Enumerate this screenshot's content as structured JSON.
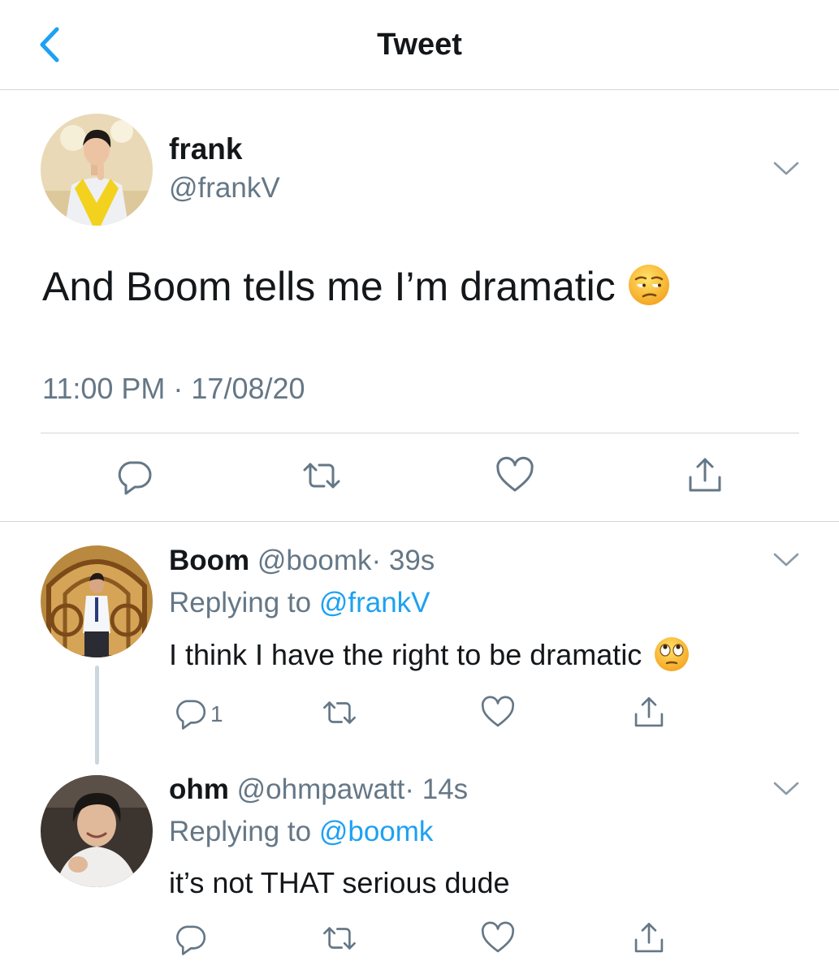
{
  "header": {
    "title": "Tweet",
    "back_icon": "chevron-left-icon",
    "accent": "#1da1f2"
  },
  "main_tweet": {
    "name": "frank",
    "handle": "@frankV",
    "text": "And Boom tells me I’m dramatic",
    "emoji": "unamused-face-icon",
    "timestamp": "11:00 PM · 17/08/20"
  },
  "replies": [
    {
      "name": "Boom",
      "handle": "@boomk",
      "time": "· 39s",
      "replying_label": "Replying to",
      "replying_handle": "@frankV",
      "text": "I think I have the right to be dramatic",
      "emoji": "eye-roll-face-icon",
      "reply_count": "1"
    },
    {
      "name": "ohm",
      "handle": "@ohmpawatt",
      "time": "· 14s",
      "replying_label": "Replying to",
      "replying_handle": "@boomk",
      "text": "it’s not THAT serious dude"
    }
  ],
  "colors": {
    "text": "#14171a",
    "secondary": "#657786",
    "link": "#1da1f2",
    "divider": "#d3d6d9"
  }
}
